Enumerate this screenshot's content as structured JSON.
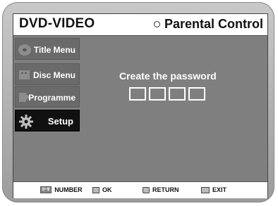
{
  "header": {
    "title": "DVD-VIDEO",
    "section": "Parental Control"
  },
  "menu": {
    "items": [
      {
        "label": "Title Menu",
        "icon": "title-menu-icon"
      },
      {
        "label": "Disc Menu",
        "icon": "disc-menu-icon"
      },
      {
        "label": "Programme",
        "icon": "programme-icon"
      },
      {
        "label": "Setup",
        "icon": "gear-icon",
        "selected": true
      }
    ]
  },
  "main": {
    "prompt": "Create the password",
    "password_digits": 4
  },
  "footer": {
    "number_key": "0~9",
    "number_label": "NUMBER",
    "ok_label": "OK",
    "return_label": "RETURN",
    "exit_label": "EXIT"
  }
}
